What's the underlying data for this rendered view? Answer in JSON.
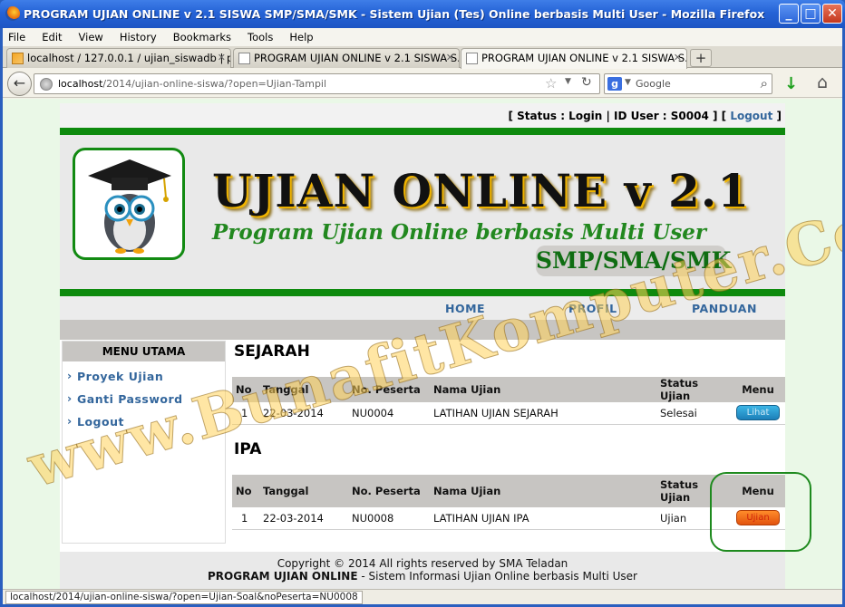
{
  "window": {
    "title": "PROGRAM UJIAN ONLINE v 2.1 SISWA SMP/SMA/SMK - Sistem Ujian (Tes) Online berbasis Multi User - Mozilla Firefox"
  },
  "menubar": [
    "File",
    "Edit",
    "View",
    "History",
    "Bookmarks",
    "Tools",
    "Help"
  ],
  "tabs": [
    {
      "label": "localhost / 127.0.0.1 / ujian_siswadb | p..."
    },
    {
      "label": "PROGRAM UJIAN ONLINE v 2.1 SISWA S..."
    },
    {
      "label": "PROGRAM UJIAN ONLINE v 2.1 SISWA S..."
    }
  ],
  "url": {
    "host": "localhost",
    "path": "/2014/ujian-online-siswa/?open=Ujian-Tampil"
  },
  "search": {
    "engine": "Google",
    "placeholder": "Google"
  },
  "site": {
    "status_text": "[ Status : Login | ID User : S0004 ] [ ",
    "logout_link": "Logout",
    "status_close": " ]",
    "title": "UJIAN ONLINE v 2.1",
    "subtitle": "Program Ujian Online berbasis Multi User",
    "schools": "SMP/SMA/SMK",
    "nav": [
      "HOME",
      "PROFIL",
      "PANDUAN"
    ],
    "sidebar": {
      "heading": "MENU UTAMA",
      "items": [
        "Proyek Ujian",
        "Ganti Password",
        "Logout"
      ]
    },
    "sections": [
      {
        "name": "SEJARAH",
        "headers": [
          "No",
          "Tanggal",
          "No. Peserta",
          "Nama Ujian",
          "Status Ujian",
          "Menu"
        ],
        "rows": [
          {
            "no": "1",
            "tanggal": "22-03-2014",
            "peserta": "NU0004",
            "nama": "LATIHAN UJIAN SEJARAH",
            "status": "Selesai",
            "button": "Lihat"
          }
        ]
      },
      {
        "name": "IPA",
        "headers": [
          "No",
          "Tanggal",
          "No. Peserta",
          "Nama Ujian",
          "Status Ujian",
          "Menu"
        ],
        "rows": [
          {
            "no": "1",
            "tanggal": "22-03-2014",
            "peserta": "NU0008",
            "nama": "LATIHAN UJIAN IPA",
            "status": "Ujian",
            "button": "Ujian"
          }
        ]
      }
    ],
    "footer": {
      "copyright": "Copyright © 2014 All rights reserved by SMA Teladan",
      "program_bold": "PROGRAM UJIAN ONLINE",
      "program_rest": " - Sistem Informasi Ujian Online berbasis Multi User"
    },
    "watermark": "www.BunafitKomputer.Com"
  },
  "statusbar": {
    "link": "localhost/2014/ujian-online-siswa/?open=Ujian-Soal&noPeserta=NU0008"
  },
  "colors": {
    "green": "#0e8a0e",
    "link": "#33669c",
    "titlebar": "#2563d6"
  }
}
